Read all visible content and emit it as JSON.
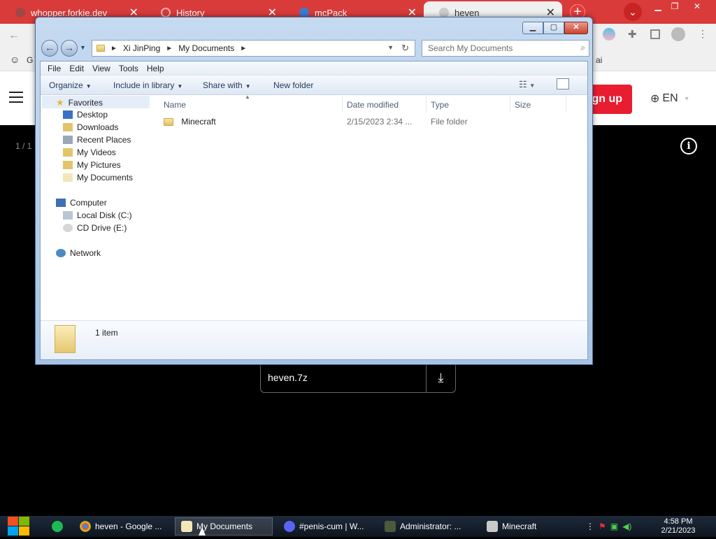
{
  "chrome": {
    "tabs": [
      {
        "title": "whopper.forkie.dev"
      },
      {
        "title": "History"
      },
      {
        "title": "mcPack"
      },
      {
        "title": "heven"
      }
    ],
    "new_tab": "+",
    "bookmark_visible": "G",
    "bookmark_right": "ai"
  },
  "website": {
    "signup": "gn up",
    "language": "EN",
    "page_counter": "1 / 1",
    "download_file": "heven.7z"
  },
  "explorer": {
    "breadcrumb": [
      "Xi JinPing",
      "My Documents"
    ],
    "search_placeholder": "Search My Documents",
    "menu": [
      "File",
      "Edit",
      "View",
      "Tools",
      "Help"
    ],
    "commands": {
      "organize": "Organize",
      "include_in_library": "Include in library",
      "share_with": "Share with",
      "new_folder": "New folder"
    },
    "nav": {
      "favorites": "Favorites",
      "favorites_items": [
        "Desktop",
        "Downloads",
        "Recent Places",
        "My Videos",
        "My Pictures",
        "My Documents"
      ],
      "computer": "Computer",
      "computer_items": [
        "Local Disk (C:)",
        "CD Drive (E:)"
      ],
      "network": "Network"
    },
    "columns": {
      "name": "Name",
      "date": "Date modified",
      "type": "Type",
      "size": "Size"
    },
    "files": [
      {
        "name": "Minecraft",
        "date": "2/15/2023 2:34 ...",
        "type": "File folder",
        "size": ""
      }
    ],
    "status": "1 item"
  },
  "taskbar": {
    "items": [
      {
        "label": "heven - Google ..."
      },
      {
        "label": "My Documents"
      },
      {
        "label": "#penis-cum | W..."
      },
      {
        "label": "Administrator: ..."
      },
      {
        "label": "Minecraft"
      }
    ],
    "time": "4:58 PM",
    "date": "2/21/2023"
  }
}
